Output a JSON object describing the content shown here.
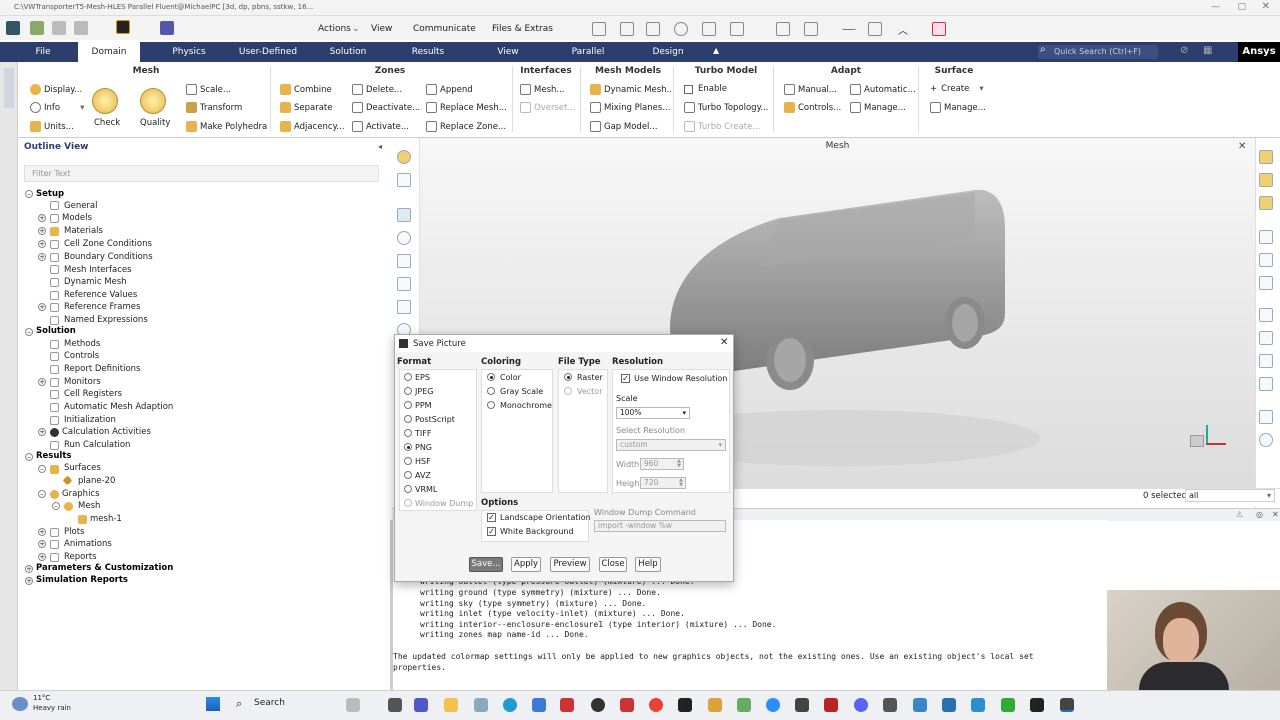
{
  "window": {
    "title": "C:\\VWTransporterT5-Mesh-HLES Parallel Fluent@MichaelPC  [3d, dp, pbns, sstkw, 16..."
  },
  "toolbar": {
    "menus": [
      "Actions",
      "View",
      "Communicate",
      "Files & Extras"
    ]
  },
  "tabs": [
    "File",
    "Domain",
    "Physics",
    "User-Defined",
    "Solution",
    "Results",
    "View",
    "Parallel",
    "Design"
  ],
  "active_tab": "Domain",
  "search": {
    "placeholder": "Quick Search (Ctrl+F)"
  },
  "brand": "Ansys",
  "ribbon": {
    "mesh": {
      "title": "Mesh",
      "display": "Display...",
      "info": "Info",
      "units": "Units...",
      "check": "Check",
      "quality": "Quality",
      "scale": "Scale...",
      "transform": "Transform",
      "polyhedra": "Make Polyhedra"
    },
    "zones": {
      "title": "Zones",
      "combine": "Combine",
      "separate": "Separate",
      "adjacency": "Adjacency...",
      "delete": "Delete...",
      "deactivate": "Deactivate...",
      "activate": "Activate...",
      "append": "Append",
      "replace_mesh": "Replace Mesh...",
      "replace_zone": "Replace Zone..."
    },
    "interfaces": {
      "title": "Interfaces",
      "mesh": "Mesh...",
      "overset": "Overset..."
    },
    "mesh_models": {
      "title": "Mesh Models",
      "dynamic": "Dynamic Mesh...",
      "mixing": "Mixing Planes...",
      "gap": "Gap Model..."
    },
    "turbo": {
      "title": "Turbo Model",
      "enable": "Enable",
      "topology": "Turbo Topology...",
      "create": "Turbo Create..."
    },
    "adapt": {
      "title": "Adapt",
      "manual": "Manual...",
      "automatic": "Automatic...",
      "controls": "Controls...",
      "manage": "Manage..."
    },
    "surface": {
      "title": "Surface",
      "create": "Create",
      "manage": "Manage..."
    }
  },
  "outline": {
    "title": "Outline View",
    "filter_placeholder": "Filter Text",
    "items": [
      "Setup",
      "General",
      "Models",
      "Materials",
      "Cell Zone Conditions",
      "Boundary Conditions",
      "Mesh Interfaces",
      "Dynamic Mesh",
      "Reference Values",
      "Reference Frames",
      "Named Expressions",
      "Solution",
      "Methods",
      "Controls",
      "Report Definitions",
      "Monitors",
      "Cell Registers",
      "Automatic Mesh Adaption",
      "Initialization",
      "Calculation Activities",
      "Run Calculation",
      "Results",
      "Surfaces",
      "plane-20",
      "Graphics",
      "Mesh",
      "mesh-1",
      "Plots",
      "Animations",
      "Reports",
      "Parameters & Customization",
      "Simulation Reports"
    ]
  },
  "graphics": {
    "title": "Mesh",
    "selected": "0 selected",
    "filter": "all"
  },
  "console": {
    "lines": [
      "writing outlet (type pressure-outlet) (mixture) ... Done.",
      "writing ground (type symmetry) (mixture) ... Done.",
      "writing sky (type symmetry) (mixture) ... Done.",
      "writing inlet (type velocity-inlet) (mixture) ... Done.",
      "writing interior--enclosure-enclosure1 (type interior) (mixture) ... Done.",
      "writing zones map name-id ... Done."
    ],
    "note1": "The updated colormap settings will only be applied to new graphics objects, not the existing ones. Use an existing object's local set",
    "note2": "properties."
  },
  "dialog": {
    "title": "Save Picture",
    "format_label": "Format",
    "formats": [
      "EPS",
      "JPEG",
      "PPM",
      "PostScript",
      "TIFF",
      "PNG",
      "HSF",
      "AVZ",
      "VRML",
      "Window Dump"
    ],
    "format_selected": "PNG",
    "coloring_label": "Coloring",
    "colorings": [
      "Color",
      "Gray Scale",
      "Monochrome"
    ],
    "filetype_label": "File Type",
    "filetypes": [
      "Raster",
      "Vector"
    ],
    "resolution_label": "Resolution",
    "use_window_res": "Use Window Resolution",
    "scale_label": "Scale",
    "scale_value": "100%",
    "select_res_label": "Select Resolution",
    "select_res_value": "custom",
    "width_label": "Width",
    "width_value": "960",
    "height_label": "Height",
    "height_value": "720",
    "options_label": "Options",
    "landscape": "Landscape Orientation",
    "white_bg": "White Background",
    "wdc_label": "Window Dump Command",
    "wdc_value": "import -window %w",
    "buttons": {
      "save": "Save...",
      "apply": "Apply",
      "preview": "Preview",
      "close": "Close",
      "help": "Help"
    }
  },
  "taskbar": {
    "weather_temp": "11°C",
    "weather_desc": "Heavy rain",
    "search": "Search"
  },
  "colors": {
    "nav": "#2c3e6e",
    "accent": "#1a73c8"
  }
}
